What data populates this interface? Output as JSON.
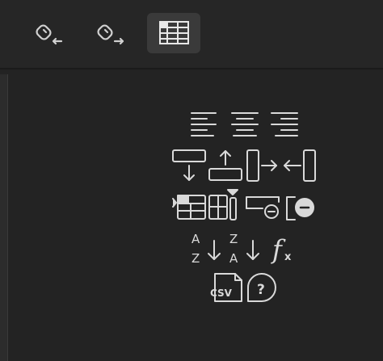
{
  "toolbar": {
    "buttons": [
      {
        "id": "link-in",
        "icon": "link-incoming-icon",
        "active": false
      },
      {
        "id": "link-out",
        "icon": "link-outgoing-icon",
        "active": false
      },
      {
        "id": "table",
        "icon": "table-icon",
        "active": true
      }
    ]
  },
  "icons": {
    "row1": [
      "align-left-icon",
      "align-center-icon",
      "align-right-icon"
    ],
    "row2": [
      "insert-row-below-icon",
      "insert-row-above-icon",
      "shrink-column-right-icon",
      "shrink-column-left-icon"
    ],
    "row3": [
      "insert-column-left-icon",
      "table-grid-icon",
      "insert-column-marker-icon",
      "delete-row-icon",
      "delete-column-icon"
    ],
    "row4": [
      "sort-ascending-icon",
      "sort-descending-icon",
      "formula-icon"
    ],
    "row5": [
      "csv-file-icon",
      "help-icon"
    ]
  },
  "labels": {
    "sort_asc_top": "A",
    "sort_asc_bottom": "Z",
    "sort_desc_top": "Z",
    "sort_desc_bottom": "A",
    "formula_f": "f",
    "formula_x": "x",
    "csv": "CSV",
    "help": "?"
  },
  "colors": {
    "toolbar_bg": "#262626",
    "content_bg": "#232323",
    "active_button_bg": "#3a3a3a",
    "icon": "#d9d9d9"
  }
}
